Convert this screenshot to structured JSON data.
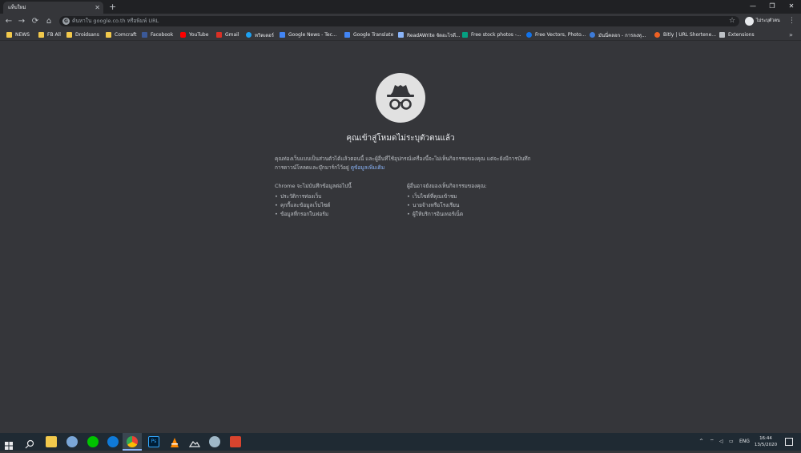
{
  "tab": {
    "title": "แท็บใหม่",
    "close": "✕",
    "new": "+"
  },
  "window": {
    "minimize": "—",
    "maximize": "❐",
    "close": "✕"
  },
  "toolbar": {
    "back": "←",
    "forward": "→",
    "reload": "⟳",
    "home": "⌂",
    "omnibox_placeholder": "ค้นหาใน google.co.th หรือพิมพ์ URL",
    "star": "☆",
    "profile_label": "ไม่ระบุตัวตน",
    "menu": "⋮"
  },
  "bookmarks": [
    {
      "label": "NEWS",
      "icon": "folder-icon",
      "color": "#f2c94c"
    },
    {
      "label": "FB All",
      "icon": "folder-icon",
      "color": "#f2c94c"
    },
    {
      "label": "Droidsans",
      "icon": "folder-icon",
      "color": "#f2c94c"
    },
    {
      "label": "Comcraft",
      "icon": "folder-icon",
      "color": "#f2c94c"
    },
    {
      "label": "Facebook",
      "icon": "facebook-icon",
      "color": "#3b5998"
    },
    {
      "label": "YouTube",
      "icon": "youtube-icon",
      "color": "#ff0000"
    },
    {
      "label": "Gmail",
      "icon": "gmail-icon",
      "color": "#d93025"
    },
    {
      "label": "ทวิตเตอร์",
      "icon": "twitter-icon",
      "color": "#1da1f2"
    },
    {
      "label": "Google News - Tec...",
      "icon": "google-news-icon",
      "color": "#4285f4"
    },
    {
      "label": "Google Translate",
      "icon": "translate-icon",
      "color": "#4285f4"
    },
    {
      "label": "ReadAWrite จัดอะไรดี...",
      "icon": "readawrite-icon",
      "color": "#8ab4f8"
    },
    {
      "label": "Free stock photos -...",
      "icon": "pexels-icon",
      "color": "#05a081"
    },
    {
      "label": "Free Vectors, Photo...",
      "icon": "freepik-icon",
      "color": "#1273eb"
    },
    {
      "label": "มันนี่คลอก - การลงทุ...",
      "icon": "site-icon",
      "color": "#3d7bd8"
    },
    {
      "label": "Bitly | URL Shortene...",
      "icon": "bitly-icon",
      "color": "#ee6123"
    },
    {
      "label": "Extensions",
      "icon": "puzzle-icon",
      "color": "#bdc1c6"
    }
  ],
  "bookmarks_more": "»",
  "incognito": {
    "title": "คุณเข้าสู่โหมดไม่ระบุตัวตนแล้ว",
    "paragraph": "คุณท่องเว็บแบบเป็นส่วนตัวได้แล้วตอนนี้ และผู้อื่นที่ใช้อุปกรณ์เครื่องนี้จะไม่เห็นกิจกรรมของคุณ แต่จะยังมีการบันทึกการดาวน์โหลดและบุ๊กมาร์กไว้อยู่",
    "learn_more": "ดูข้อมูลเพิ่มเติม",
    "left_heading": "Chrome จะไม่บันทึกข้อมูลต่อไปนี้",
    "left_items": [
      "ประวัติการท่องเว็บ",
      "คุกกี้และข้อมูลเว็บไซต์",
      "ข้อมูลที่กรอกในฟอร์ม"
    ],
    "right_heading": "ผู้อื่นอาจยังมองเห็นกิจกรรมของคุณ:",
    "right_items": [
      "เว็บไซต์ที่คุณเข้าชม",
      "นายจ้างหรือโรงเรียน",
      "ผู้ให้บริการอินเทอร์เน็ต"
    ]
  },
  "taskbar": {
    "apps": [
      {
        "icon": "file-explorer-icon",
        "color": "#f2c94c"
      },
      {
        "icon": "app-icon",
        "color": "#7aa7d8"
      },
      {
        "icon": "line-icon",
        "color": "#00c300"
      },
      {
        "icon": "edge-icon",
        "color": "#0f7ad8"
      },
      {
        "icon": "chrome-icon",
        "color": "#e8eaed"
      },
      {
        "icon": "photoshop-icon",
        "color": "#001e36"
      },
      {
        "icon": "vlc-icon",
        "color": "#ff8800"
      },
      {
        "icon": "photos-icon",
        "color": "#2d2d2d"
      },
      {
        "icon": "app-icon",
        "color": "#9fb8c8"
      },
      {
        "icon": "app-icon",
        "color": "#d8442e"
      }
    ],
    "lang": "ENG",
    "time": "16:44",
    "date": "13/5/2020"
  }
}
